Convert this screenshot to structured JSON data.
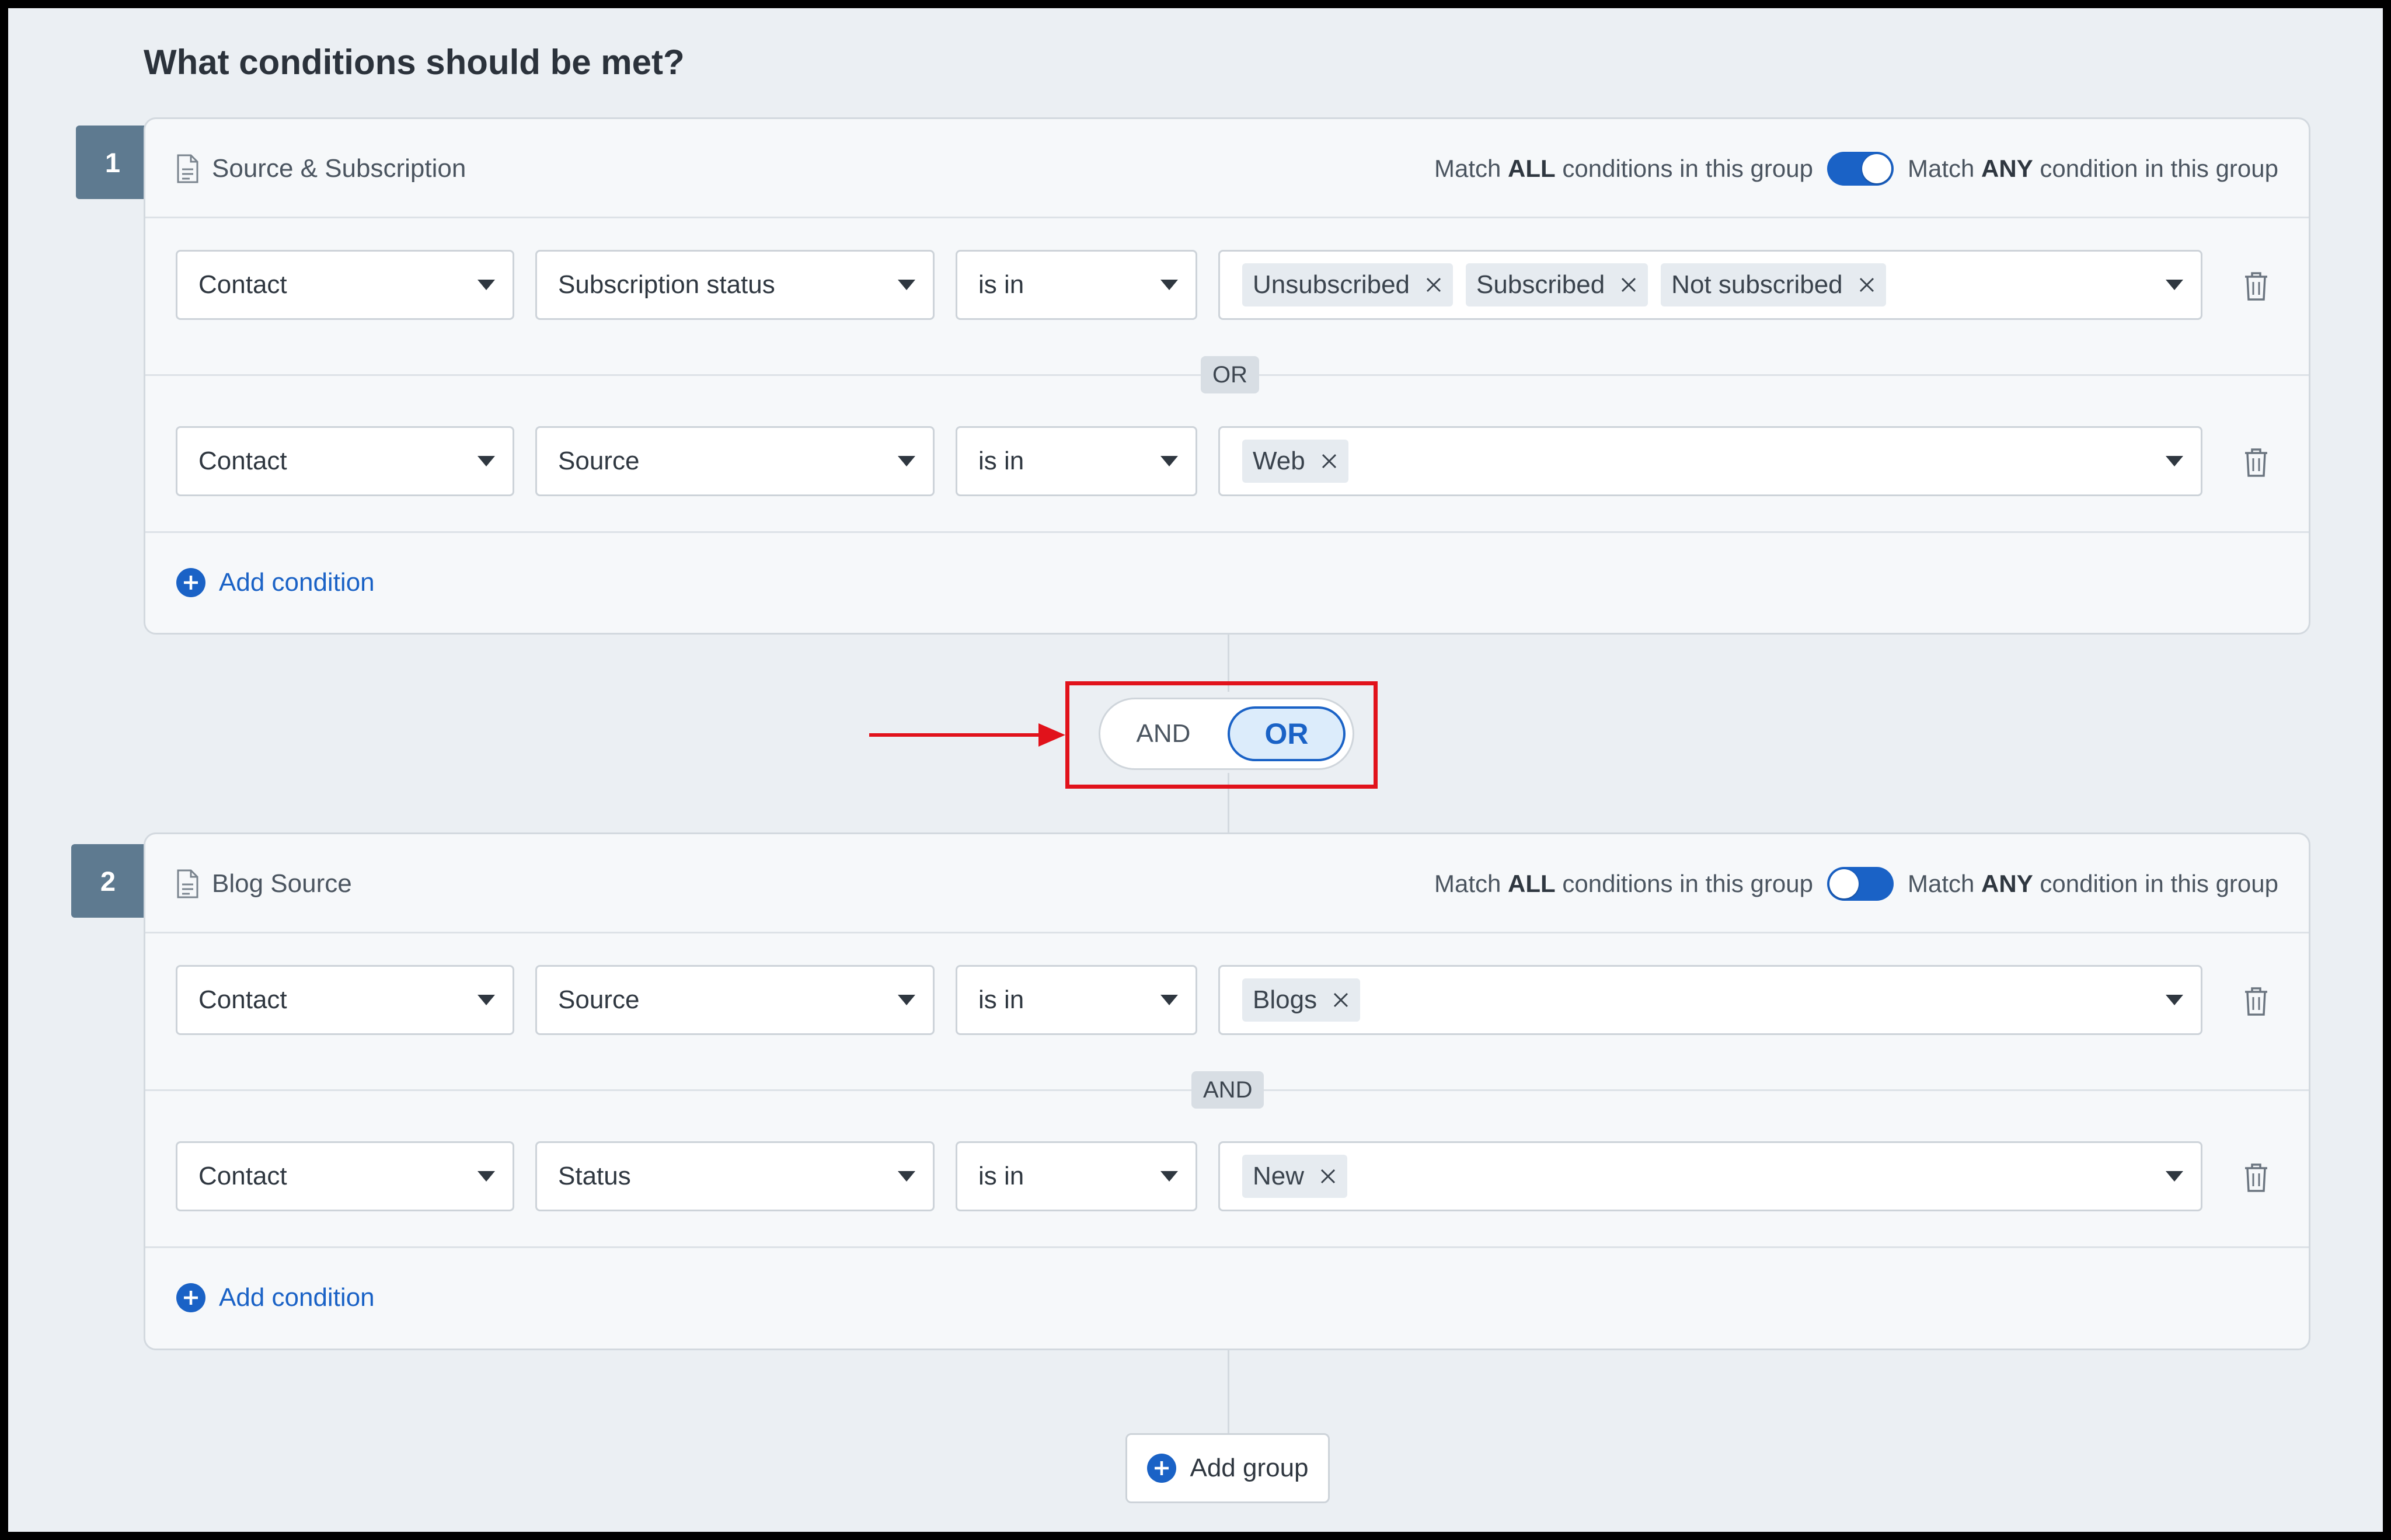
{
  "page": {
    "title": "What conditions should be met?"
  },
  "match_labels": {
    "prefix": "Match",
    "all_word": "ALL",
    "all_suffix": "conditions in this group",
    "any_word": "ANY",
    "any_suffix": "condition in this group"
  },
  "groups": [
    {
      "number": "1",
      "name": "Source & Subscription",
      "toggle_state": "any",
      "rows": [
        {
          "entity": "Contact",
          "field": "Subscription status",
          "operator": "is in",
          "values": [
            "Unsubscribed",
            "Subscribed",
            "Not subscribed"
          ]
        },
        {
          "entity": "Contact",
          "field": "Source",
          "operator": "is in",
          "values": [
            "Web"
          ]
        }
      ],
      "row_joiner": "OR",
      "add_condition_label": "Add condition"
    },
    {
      "number": "2",
      "name": "Blog Source",
      "toggle_state": "all",
      "rows": [
        {
          "entity": "Contact",
          "field": "Source",
          "operator": "is in",
          "values": [
            "Blogs"
          ]
        },
        {
          "entity": "Contact",
          "field": "Status",
          "operator": "is in",
          "values": [
            "New"
          ]
        }
      ],
      "row_joiner": "AND",
      "add_condition_label": "Add condition"
    }
  ],
  "group_joiner": {
    "and_label": "AND",
    "or_label": "OR",
    "selected": "OR"
  },
  "add_group_label": "Add group",
  "colors": {
    "accent": "#1a62c6",
    "highlight": "#e1121b",
    "badge": "#5e7a90"
  },
  "icons": {
    "group_icon": "document-icon",
    "chip_remove": "close-icon",
    "row_delete": "trash-icon",
    "add": "plus-circle-icon",
    "dropdown": "caret-down-icon"
  }
}
